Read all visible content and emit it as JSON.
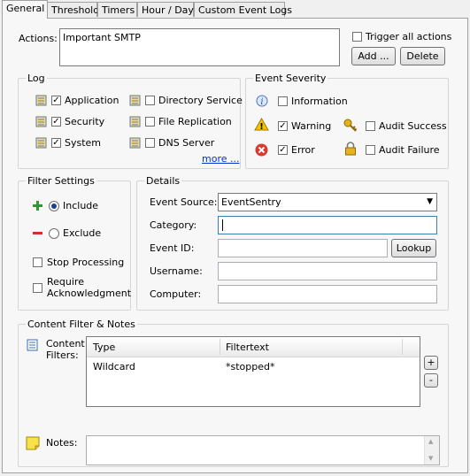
{
  "tabs": [
    "General",
    "Threshold",
    "Timers",
    "Hour / Day",
    "Custom Event Logs"
  ],
  "actions": {
    "label": "Actions:",
    "value": "Important SMTP",
    "trigger_all_label": "Trigger all actions",
    "add_label": "Add ...",
    "delete_label": "Delete"
  },
  "log": {
    "title": "Log",
    "items": [
      {
        "label": "Application",
        "checked": true
      },
      {
        "label": "Security",
        "checked": true
      },
      {
        "label": "System",
        "checked": true
      },
      {
        "label": "Directory Service",
        "checked": false
      },
      {
        "label": "File Replication",
        "checked": false
      },
      {
        "label": "DNS Server",
        "checked": false
      }
    ],
    "more_label": "more ..."
  },
  "severity": {
    "title": "Event Severity",
    "information_label": "Information",
    "warning_label": "Warning",
    "error_label": "Error",
    "audit_success_label": "Audit Success",
    "audit_failure_label": "Audit Failure"
  },
  "filter": {
    "title": "Filter Settings",
    "include_label": "Include",
    "exclude_label": "Exclude",
    "stop_processing_label": "Stop Processing",
    "require_ack_label_1": "Require",
    "require_ack_label_2": "Acknowledgment"
  },
  "details": {
    "title": "Details",
    "event_source_label": "Event Source:",
    "event_source_value": "EventSentry",
    "category_label": "Category:",
    "event_id_label": "Event ID:",
    "lookup_label": "Lookup",
    "username_label": "Username:",
    "computer_label": "Computer:"
  },
  "content": {
    "title": "Content Filter & Notes",
    "filters_label_1": "Content",
    "filters_label_2": "Filters:",
    "columns": [
      "Type",
      "Filtertext"
    ],
    "rows": [
      [
        "Wildcard",
        "*stopped*"
      ]
    ],
    "plus_label": "+",
    "minus_label": "-",
    "notes_label": "Notes:"
  },
  "colors": {
    "accent": "#0033cc",
    "selection": "#1c3f8f"
  }
}
